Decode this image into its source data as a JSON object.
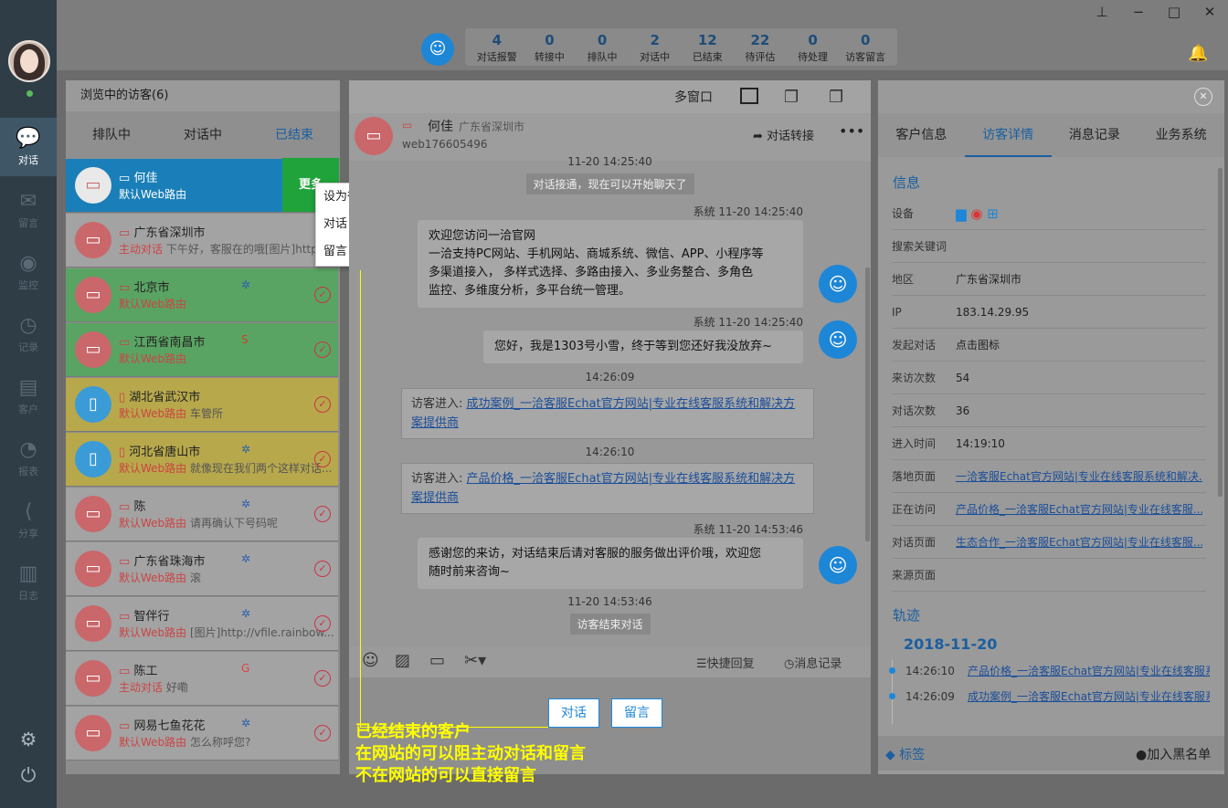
{
  "rail": {
    "items": [
      {
        "label": "对话",
        "icon": "chat-icon"
      },
      {
        "label": "留言",
        "icon": "mail-icon"
      },
      {
        "label": "监控",
        "icon": "eye-icon"
      },
      {
        "label": "记录",
        "icon": "clock-icon"
      },
      {
        "label": "客户",
        "icon": "id-card-icon"
      },
      {
        "label": "报表",
        "icon": "pie-chart-icon"
      },
      {
        "label": "分享",
        "icon": "share-icon"
      },
      {
        "label": "日志",
        "icon": "clipboard-icon"
      }
    ]
  },
  "stats": [
    {
      "n": "4",
      "l": "对话报警"
    },
    {
      "n": "0",
      "l": "转接中"
    },
    {
      "n": "0",
      "l": "排队中"
    },
    {
      "n": "2",
      "l": "对话中"
    },
    {
      "n": "12",
      "l": "已结束"
    },
    {
      "n": "22",
      "l": "待评估"
    },
    {
      "n": "0",
      "l": "待处理"
    },
    {
      "n": "0",
      "l": "访客留言"
    }
  ],
  "left": {
    "header": "浏览中的访客(6)",
    "tabs": [
      "排队中",
      "对话中",
      "已结束"
    ],
    "more": "更多",
    "menu": [
      "设为待处理",
      "对话",
      "留言"
    ],
    "visitors": [
      {
        "name": "何佳",
        "route": "默认Web路由",
        "msg": "",
        "bg": "#1a7fb8",
        "device": "pc"
      },
      {
        "name": "广东省深圳市",
        "route": "主动对话",
        "msg": "下午好，客服在的哦[图片]http:",
        "bg": "#a3a3a3",
        "device": "pc"
      },
      {
        "name": "北京市",
        "route": "默认Web路由",
        "msg": "",
        "bg": "#5aa463",
        "device": "pc",
        "badge": "✲"
      },
      {
        "name": "江西省南昌市",
        "route": "默认Web路由",
        "msg": "",
        "bg": "#5aa463",
        "device": "pc",
        "badge": "S"
      },
      {
        "name": "湖北省武汉市",
        "route": "默认Web路由",
        "msg": "车管所",
        "bg": "#b7a84c",
        "device": "mobile"
      },
      {
        "name": "河北省唐山市",
        "route": "默认Web路由",
        "msg": "就像现在我们两个这样对话...",
        "bg": "#b7a84c",
        "device": "mobile",
        "badge": "✲"
      },
      {
        "name": "陈",
        "route": "默认Web路由",
        "msg": "请再确认下号码呢",
        "bg": "#a3a3a3",
        "device": "pc",
        "badge": "✲"
      },
      {
        "name": "广东省珠海市",
        "route": "默认Web路由",
        "msg": "滚",
        "bg": "#a3a3a3",
        "device": "pc",
        "badge": "✲"
      },
      {
        "name": "智伴行",
        "route": "默认Web路由",
        "msg": "[图片]http://vfile.rainbow...",
        "bg": "#a3a3a3",
        "device": "pc",
        "badge": "✲"
      },
      {
        "name": "陈工",
        "route": "主动对话",
        "msg": "好嘞",
        "bg": "#a3a3a3",
        "device": "pc",
        "badge": "G"
      },
      {
        "name": "网易七鱼花花",
        "route": "默认Web路由",
        "msg": "怎么称呼您?",
        "bg": "#a3a3a3",
        "device": "pc",
        "badge": "✲"
      }
    ]
  },
  "chat": {
    "multi": "多窗口",
    "visitor_name": "何佳",
    "visitor_loc": "广东省深圳市",
    "visitor_id": "web176605496",
    "transfer": "对话转接",
    "t0": "11-20 14:25:40",
    "sys1": "对话接通，现在可以开始聊天了",
    "st1": "系统  11-20 14:25:40",
    "b1": [
      "欢迎您访问一洽官网",
      "一洽支持PC网站、手机网站、商城系统、微信、APP、小程序等",
      "多渠道接入， 多样式选择、多路由接入、多业务整合、多角色",
      "监控、多维度分析，多平台统一管理。"
    ],
    "st2": "系统  11-20 14:25:40",
    "b2": "您好，我是1303号小雪，终于等到您还好我没放弃~",
    "t3": "14:26:09",
    "v1_prefix": "访客进入:",
    "v1_link": "成功案例_一洽客服Echat官方网站|专业在线客服系统和解决方案提供商",
    "t4": "14:26:10",
    "v2_prefix": "访客进入:",
    "v2_link": "产品价格_一洽客服Echat官方网站|专业在线客服系统和解决方案提供商",
    "st3": "系统  11-20 14:53:46",
    "b3": [
      "感谢您的来访，对话结束后请对客服的服务做出评价哦，欢迎您",
      "随时前来咨询~"
    ],
    "t5": "11-20 14:53:46",
    "sys2": "访客结束对话",
    "quick": "快捷回复",
    "history": "消息记录",
    "btn_chat": "对话",
    "btn_msg": "留言"
  },
  "annotation": [
    "已经结束的客户",
    "在网站的可以阻主动对话和留言",
    "不在网站的可以直接留言"
  ],
  "right": {
    "tabs": [
      "客户信息",
      "访客详情",
      "消息记录",
      "业务系统"
    ],
    "info_title": "信息",
    "rows": [
      {
        "k": "设备",
        "v": ""
      },
      {
        "k": "搜索关键词",
        "v": ""
      },
      {
        "k": "地区",
        "v": "广东省深圳市"
      },
      {
        "k": "IP",
        "v": "183.14.29.95"
      },
      {
        "k": "发起对话",
        "v": "点击图标"
      },
      {
        "k": "来访次数",
        "v": "54"
      },
      {
        "k": "对话次数",
        "v": "36"
      },
      {
        "k": "进入时间",
        "v": "14:19:10"
      },
      {
        "k": "落地页面",
        "v": "一洽客服Echat官方网站|专业在线客服系统和解决..."
      },
      {
        "k": "正在访问",
        "v": "产品价格_一洽客服Echat官方网站|专业在线客服..."
      },
      {
        "k": "对话页面",
        "v": "生态合作_一洽客服Echat官方网站|专业在线客服..."
      },
      {
        "k": "来源页面",
        "v": ""
      }
    ],
    "track_title": "轨迹",
    "date": "2018-11-20",
    "track": [
      {
        "t": "14:26:10",
        "l": "产品价格_一洽客服Echat官方网站|专业在线客服系统"
      },
      {
        "t": "14:26:09",
        "l": "成功案例_一洽客服Echat官方网站|专业在线客服系统"
      }
    ],
    "tags": "标签",
    "blacklist": "加入黑名单"
  }
}
